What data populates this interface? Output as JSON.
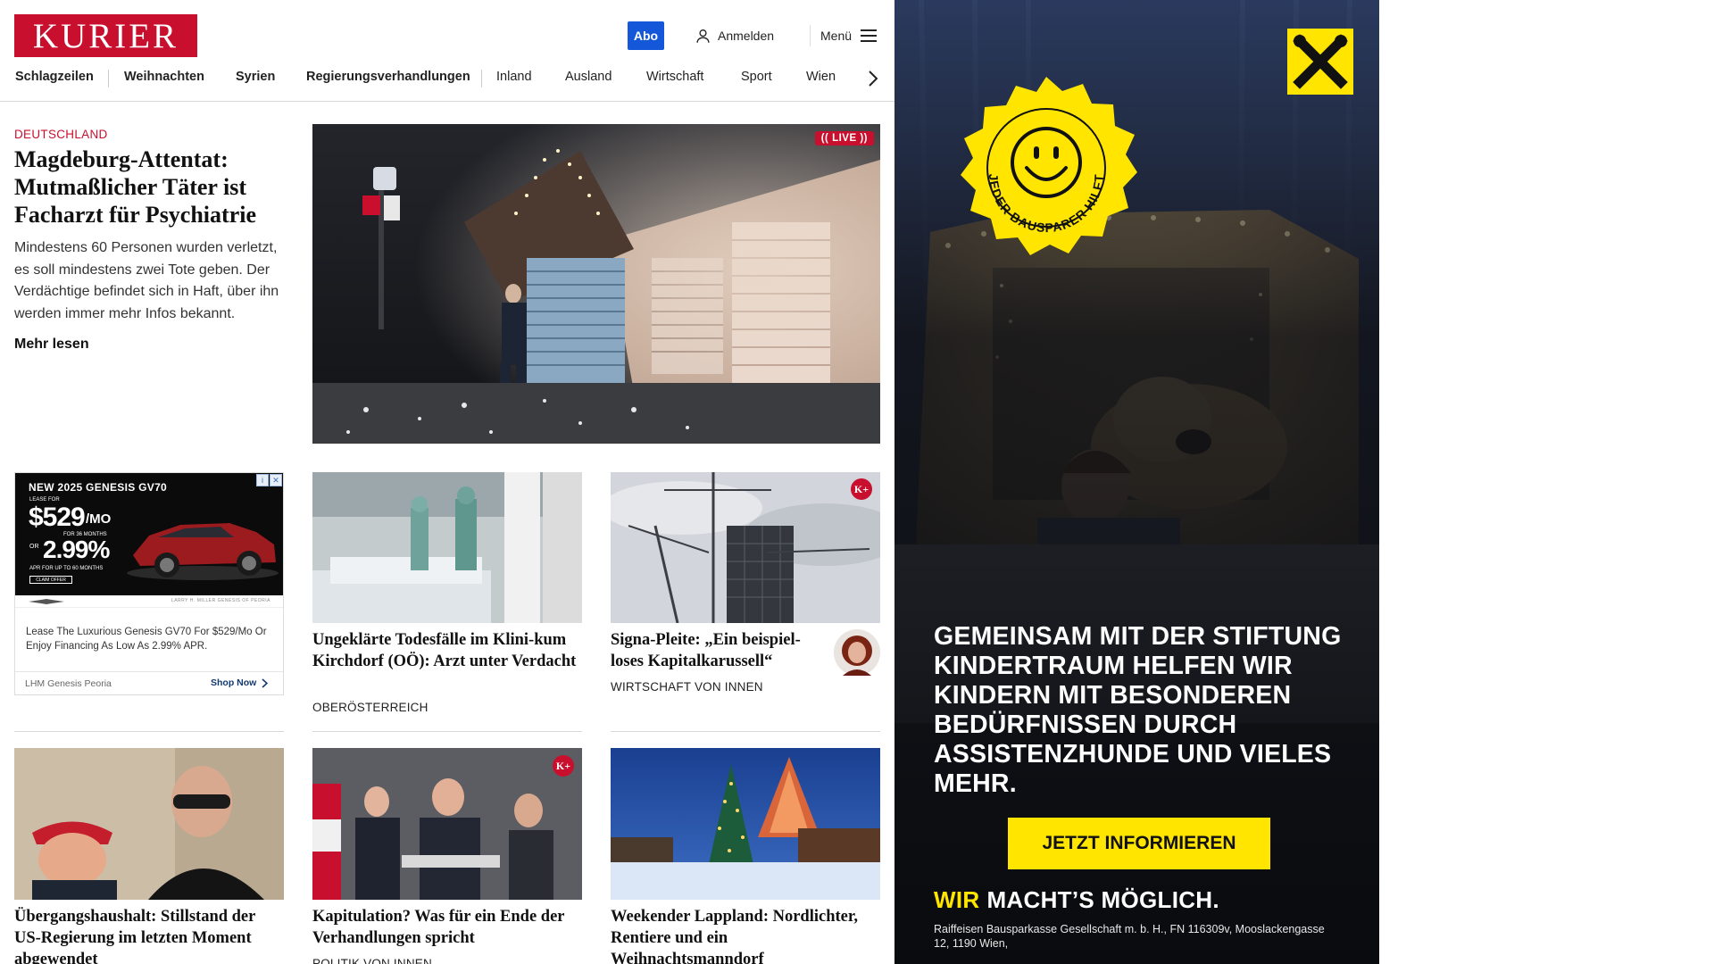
{
  "header": {
    "logo": "KURIER",
    "abo_label": "Abo",
    "login_label": "Anmelden",
    "menu_label": "Menü"
  },
  "nav": {
    "items": [
      {
        "label": "Schlagzeilen"
      },
      {
        "label": "Weihnachten"
      },
      {
        "label": "Syrien"
      },
      {
        "label": "Regierungsverhandlungen"
      },
      {
        "label": "Inland"
      },
      {
        "label": "Ausland"
      },
      {
        "label": "Wirtschaft"
      },
      {
        "label": "Sport"
      },
      {
        "label": "Wien"
      }
    ]
  },
  "hero": {
    "kicker": "DEUTSCHLAND",
    "title": "Magdeburg-Attentat: Mutmaßlicher Täter ist Facharzt für Psychiatrie",
    "teaser": "Mindestens 60 Personen wurden verletzt, es soll mindestens zwei Tote geben. Der Verdächtige befindet sich in Haft, über ihn werden immer mehr Infos bekannt.",
    "more_label": "Mehr lesen",
    "live_label": "(( LIVE ))"
  },
  "cards": [
    {
      "title": "Ungeklärte Todesfälle im Klini-kum Kirchdorf (OÖ): Arzt unter Verdacht",
      "kicker": "OBERÖSTERREICH",
      "kplus": ""
    },
    {
      "title": "Signa-Pleite: „Ein beispiel-loses Kapitalkarussell“",
      "kicker": "WIRTSCHAFT VON INNEN",
      "kplus": "K+"
    },
    {
      "title": "Übergangshaushalt: Stillstand der US-Regierung im letzten Moment abgewendet",
      "kicker": "",
      "kplus": ""
    },
    {
      "title": "Kapitulation? Was für ein Ende der Verhandlungen spricht",
      "kicker": "POLITIK VON INNEN",
      "kplus": "K+"
    },
    {
      "title": "Weekender Lappland: Nordlichter, Rentiere und ein Weihnachtsmanndorf",
      "kicker": "",
      "kplus": ""
    }
  ],
  "genesis_ad": {
    "headline": "NEW 2025 GENESIS GV70",
    "lease_for": "LEASE FOR",
    "price": "$529",
    "per_month": "/MO",
    "months_1": "FOR 36 MONTHS",
    "or": "OR",
    "apr": "2.99%",
    "months_2": "APR FOR UP TO 60 MONTHS",
    "claim": "CLAIM OFFER",
    "dealer_small": "LARRY H. MILLER GENESIS OF PEORIA",
    "description": "Lease The Luxurious Genesis GV70 For $529/Mo Or Enjoy Financing As Low As 2.99% APR.",
    "advertiser": "LHM Genesis Peoria",
    "shop_label": "Shop Now"
  },
  "right_ad": {
    "seal_text": "JEDER BAUSPARER HILFT",
    "copy": "GEMEINSAM MIT DER STIFTUNG KINDERTRAUM HELFEN WIR KINDERN MIT BESONDEREN BEDÜRFNISSEN DURCH ASSISTENZHUNDE UND VIELES MEHR.",
    "cta": "JETZT INFORMIEREN",
    "tag_wir": "WIR",
    "tag_rest": "MACHT’S MÖGLICH.",
    "legal": "Raiffeisen Bausparkasse Gesellschaft m. b. H., FN 116309v, Mooslackengasse 12, 1190 Wien,"
  },
  "colors": {
    "brand_red": "#c8102e",
    "abo_blue": "#1457d9",
    "ad_yellow": "#ffe500"
  }
}
